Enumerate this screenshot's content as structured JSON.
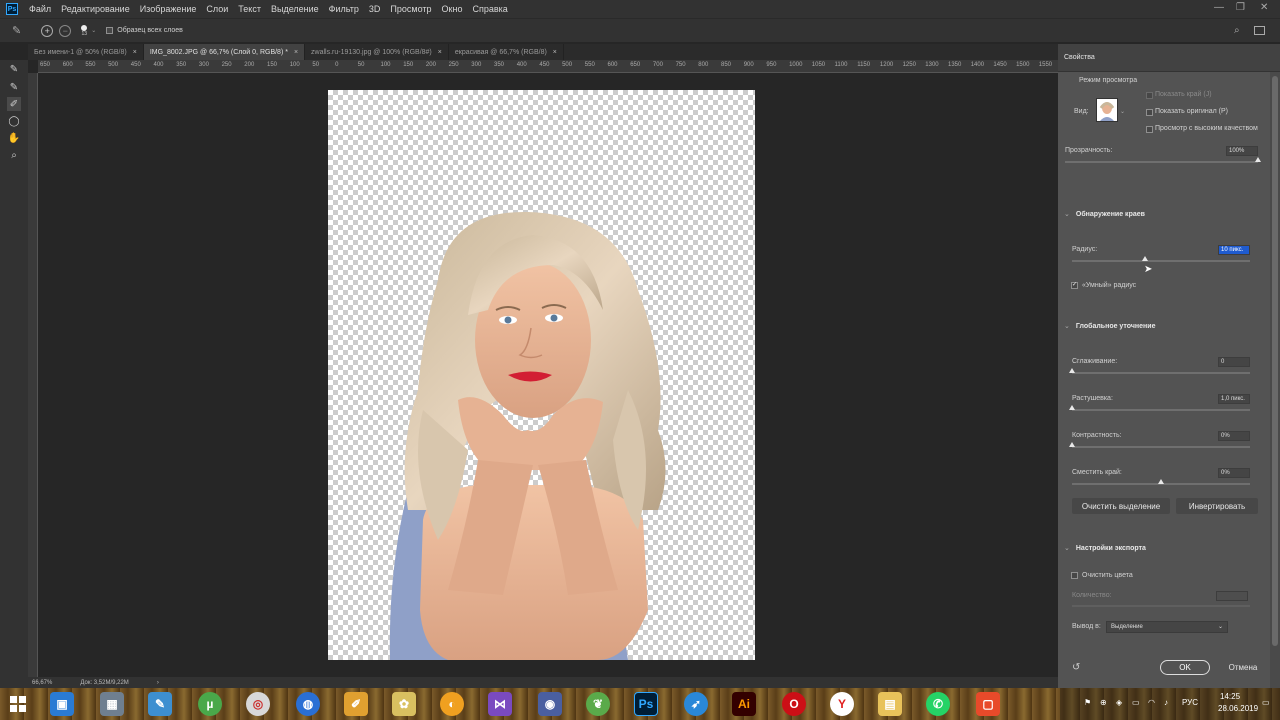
{
  "app": {
    "logo": "Ps"
  },
  "menu": [
    "Файл",
    "Редактирование",
    "Изображение",
    "Слои",
    "Текст",
    "Выделение",
    "Фильтр",
    "3D",
    "Просмотр",
    "Окно",
    "Справка"
  ],
  "options": {
    "brush_size": "13",
    "sample_all_layers": "Образец всех слоев"
  },
  "tabs": [
    {
      "label": "Без имени-1 @ 50% (RGB/8)",
      "close": "×",
      "active": false
    },
    {
      "label": "IMG_8002.JPG @ 66,7% (Слой 0, RGB/8) *",
      "close": "×",
      "active": true
    },
    {
      "label": "zwalls.ru-19130.jpg @ 100% (RGB/8#)",
      "close": "×",
      "active": false
    },
    {
      "label": "екрасивая @ 66,7% (RGB/8)",
      "close": "×",
      "active": false
    }
  ],
  "ruler_h": [
    "650",
    "600",
    "550",
    "500",
    "450",
    "400",
    "350",
    "300",
    "250",
    "200",
    "150",
    "100",
    "50",
    "0",
    "50",
    "100",
    "150",
    "200",
    "250",
    "300",
    "350",
    "400",
    "450",
    "500",
    "550",
    "600",
    "650",
    "700",
    "750",
    "800",
    "850",
    "900",
    "950",
    "1000",
    "1050",
    "1100",
    "1150",
    "1200",
    "1250",
    "1300",
    "1350",
    "1400",
    "1450",
    "1500",
    "1550",
    "1600",
    "1650"
  ],
  "status": {
    "zoom": "66,67%",
    "doc": "Док: 3,52M/9,22M",
    "arrow": "›"
  },
  "panel": {
    "title": "Свойства",
    "view_mode": {
      "heading": "Режим просмотра",
      "view_label": "Вид:",
      "show_edge": "Показать край (J)",
      "show_original": "Показать оригинал (P)",
      "high_quality": "Просмотр с высоким качеством"
    },
    "opacity": {
      "label": "Прозрачность:",
      "value": "100%",
      "level": 1.0
    },
    "edge_detection": {
      "heading": "Обнаружение краев",
      "radius_label": "Радиус:",
      "radius_value": "10 пикс.",
      "radius_level": 0.41,
      "smart_radius": "«Умный» радиус",
      "smart_radius_checked": true
    },
    "global_refine": {
      "heading": "Глобальное уточнение",
      "smooth_label": "Сглаживание:",
      "smooth_value": "0",
      "smooth_level": 0,
      "feather_label": "Растушевка:",
      "feather_value": "1,0 пикс.",
      "feather_level": 0,
      "contrast_label": "Контрастность:",
      "contrast_value": "0%",
      "contrast_level": 0,
      "shift_label": "Сместить край:",
      "shift_value": "0%",
      "shift_level": 0.5
    },
    "buttons": {
      "clear": "Очистить выделение",
      "invert": "Инвертировать"
    },
    "export": {
      "heading": "Настройки экспорта",
      "decontaminate": "Очистить цвета",
      "amount_label": "Количество:",
      "output_label": "Вывод в:",
      "output_value": "Выделение"
    },
    "ok": "OK",
    "cancel": "Отмена"
  },
  "taskbar": {
    "lang": "РУС",
    "time": "14:25",
    "date": "28.06.2019"
  },
  "colors": {
    "accent": "#1473e6",
    "panel": "#535353",
    "selection": "#1f5bcf"
  }
}
